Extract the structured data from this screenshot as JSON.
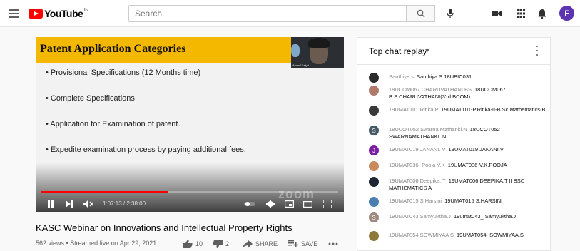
{
  "header": {
    "logo_text": "YouTube",
    "logo_suffix": "IN",
    "search_placeholder": "Search",
    "avatar_letter": "F",
    "avatar_color": "#5e35b1"
  },
  "player": {
    "slide_title": "Patent Application Categories",
    "webcam_label": "Anand Kalyd...",
    "bullets": [
      "• Provisional Specifications (12 Months time)",
      "• Complete Specifications",
      "• Application for Examination of patent.",
      "• Expedite examination process by paying additional fees."
    ],
    "watermark": "zoom",
    "time_display": "1:07:13 / 2:38:00",
    "progress_fraction": 0.425,
    "accent_color": "#ff0000"
  },
  "video": {
    "title": "KASC Webinar on Innovations and Intellectual Property Rights",
    "meta": "562 views • Streamed live on Apr 29, 2021",
    "likes": "10",
    "dislikes": "2",
    "share_label": "SHARE",
    "save_label": "SAVE"
  },
  "chat": {
    "header_label": "Top chat replay",
    "messages": [
      {
        "author": "Santhiya.s",
        "text": "Santhiya.S 18UBIC031",
        "avatar_color": "#2b2b2b",
        "initial": ""
      },
      {
        "author": "18UCOM067 CHARUVATHANI BS",
        "text": "18UCOM067 B.S.CHARUVATHANI(3'rd BCOM)",
        "avatar_color": "#b07a6a",
        "initial": ""
      },
      {
        "author": "19UMAT101 Ritika.P",
        "text": "19UMAT101-P.Ritika-II-B.Sc.Mathematics-B",
        "avatar_color": "#3a3a3a",
        "initial": ""
      },
      {
        "author": "18UCOT052 Swarna Mathanki.N",
        "text": "18UCOT052 SWARNAMATHANKI. N",
        "avatar_color": "#455a64",
        "initial": "S"
      },
      {
        "author": "19UMAT019 JANANI. V",
        "text": "19UMAT019 JANANI.V",
        "avatar_color": "#7b1fa2",
        "initial": "J"
      },
      {
        "author": "19UMAT036- Pooja V.K",
        "text": "19UMAT036-V.K.POOJA",
        "avatar_color": "#c98a5e",
        "initial": ""
      },
      {
        "author": "19UMAT006 Deepika. T",
        "text": "19UMAT006 DEEPIKA.T II BSC MATHEMATICS A",
        "avatar_color": "#1d2733",
        "initial": ""
      },
      {
        "author": "19UMAT015 S.Harsini",
        "text": "19UMAT015 S.HARSINI",
        "avatar_color": "#4a7fb0",
        "initial": ""
      },
      {
        "author": "19UMAT043 Samyuktha.J",
        "text": "19umat043_ Samyuktha.J",
        "avatar_color": "#a1887f",
        "initial": "S"
      },
      {
        "author": "19UMAT054 SOWMIYAA S",
        "text": "19UMAT054- SOWMIYAA.S",
        "avatar_color": "#8d7a3a",
        "initial": ""
      }
    ]
  }
}
